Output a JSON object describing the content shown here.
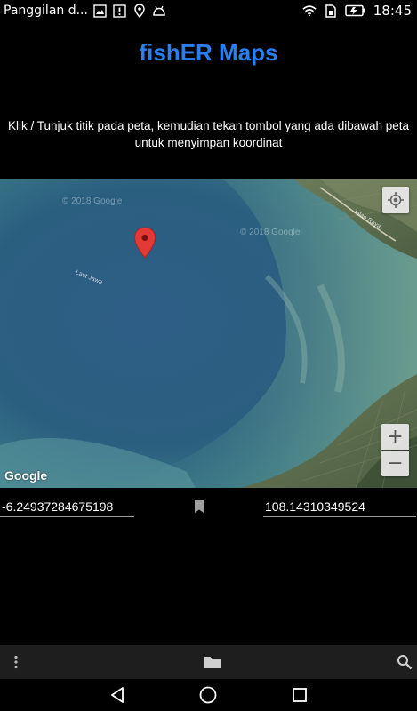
{
  "status_bar": {
    "notification_text": "Panggilan d...",
    "time": "18:45",
    "left_icons": [
      "image-icon",
      "alert-icon",
      "location-icon",
      "android-icon"
    ],
    "right_icons": [
      "wifi-icon",
      "sim-icon",
      "battery-icon"
    ]
  },
  "app": {
    "title": "fishER Maps",
    "title_color": "#2a7ff0",
    "instructions": "Klik / Tunjuk titik pada peta, kemudian tekan tombol yang ada dibawah peta untuk menyimpan koordinat"
  },
  "map": {
    "copyright_1": "© 2018 Google",
    "copyright_2": "© 2018 Google",
    "road_label": "Jalan Raya",
    "water_label": "Laut Jawa",
    "google_logo": "Google",
    "zoom_in_label": "+",
    "zoom_out_label": "−",
    "marker_color": "#e53935"
  },
  "coordinates": {
    "latitude": "-6.24937284675198",
    "longitude": "108.14310349524"
  },
  "toolbar": {
    "icons": [
      "more-vert-icon",
      "folder-icon",
      "search-icon"
    ]
  },
  "navigation": {
    "icons": [
      "back-icon",
      "home-icon",
      "recent-apps-icon"
    ]
  }
}
